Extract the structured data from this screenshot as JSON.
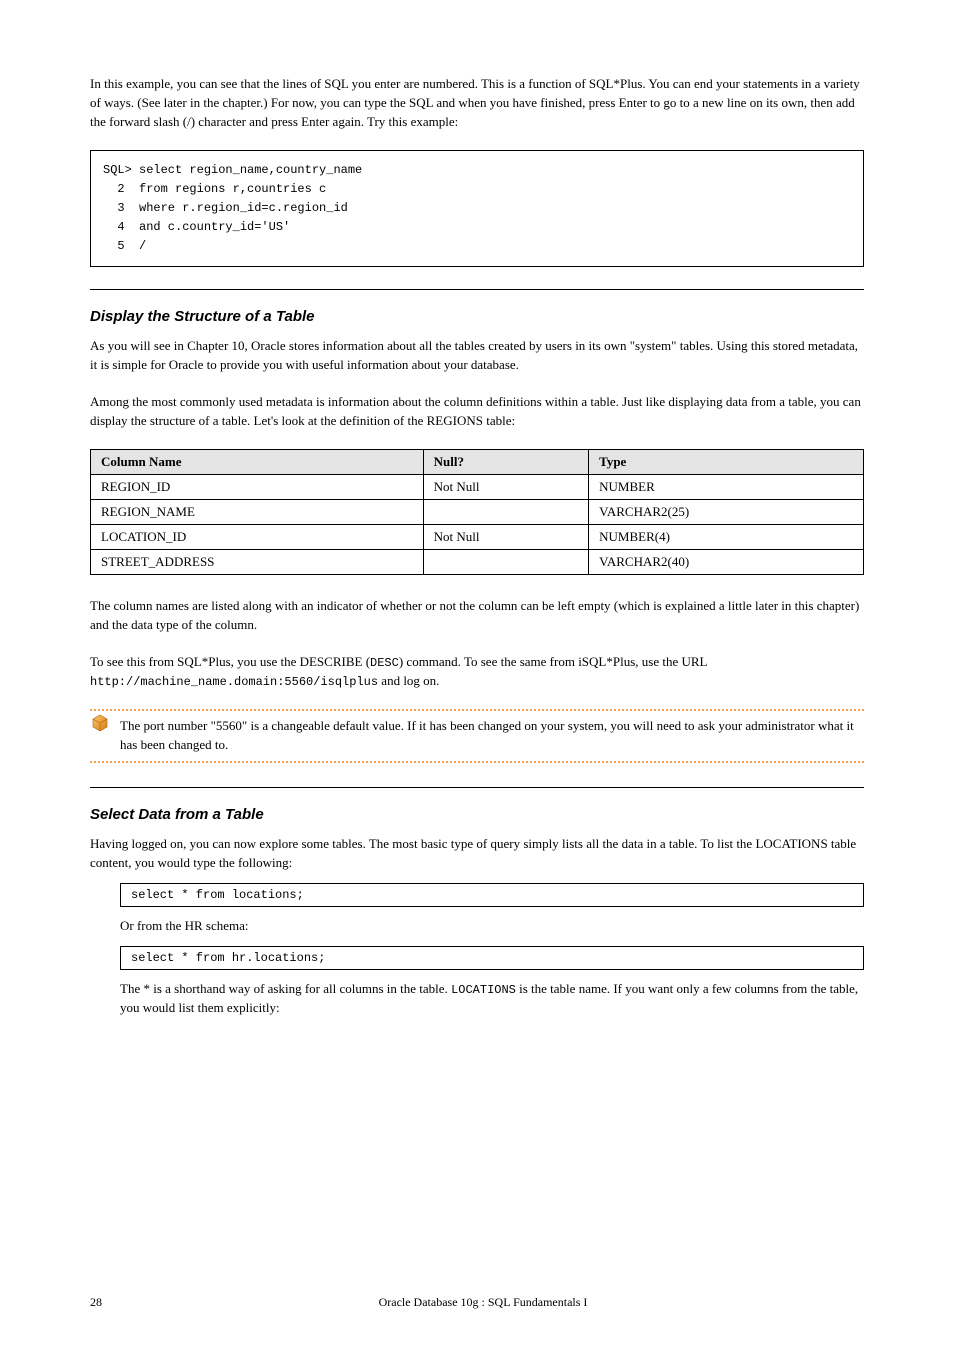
{
  "intro_para": "In this example, you can see that the lines of SQL you enter are numbered. This is a function of SQL*Plus. You can end your statements in a variety of ways. (See later in the chapter.) For now, you can type the SQL and when you have finished, press Enter to go to a new line on its own, then add the forward slash (/) character and press Enter again. Try this example:",
  "example_lines": [
    "SQL> select region_name,country_name",
    "  2  from regions r,countries c",
    "  3  where r.region_id=c.region_id",
    "  4  and c.country_id='US'",
    "  5  /"
  ],
  "section1_title": "Display the Structure of a Table",
  "section1_para1": "As you will see in Chapter 10, Oracle stores information about all the tables created by users in its own \"system\" tables. Using this stored metadata, it is simple for Oracle to provide you with useful information about your database.",
  "section1_para2": "Among the most commonly used metadata is information about the column definitions within a table. Just like displaying data from a table, you can display the structure of a table. Let's look at the definition of the REGIONS table:",
  "table": {
    "headers": [
      "Column Name",
      "Null?",
      "Type"
    ],
    "rows": [
      [
        "REGION_ID",
        "Not Null",
        "NUMBER"
      ],
      [
        "REGION_NAME",
        "",
        "VARCHAR2(25)"
      ],
      [
        "LOCATION_ID",
        "Not Null",
        "NUMBER(4)"
      ],
      [
        "STREET_ADDRESS",
        "",
        "VARCHAR2(40)"
      ]
    ]
  },
  "section1_para3": "The column names are listed along with an indicator of whether or not the column can be left empty (which is explained a little later in this chapter) and the data type of the column.",
  "section1_para4_a": "To see this from SQL*Plus, you use the DESCRIBE (",
  "section1_para4_desc": "DESC",
  "section1_para4_b": ") command. To see the same from iSQL*Plus, use the URL",
  "section1_url": "http://machine_name.domain:5560/isqlplus",
  "section1_para4_c": "and log on.",
  "tip_text": "The port number \"5560\" is a changeable default value. If it has been changed on your system, you will need to ask your administrator what it has been changed to.",
  "section2_title": "Select Data from a Table",
  "section2_para1": "Having logged on, you can now explore some tables. The most basic type of query simply lists all the data in a table. To list the LOCATIONS table content, you would type the following:",
  "code1": "select  *  from locations;",
  "section2_para2": "Or from the HR schema:",
  "code2": "select  *  from hr.locations;",
  "section2_para3_a": "The * is a shorthand way of asking for all columns in the table. ",
  "section2_para3_b": "LOCATIONS",
  "section2_para3_c": " is the table name. If you want only a few columns from the table, you would list them explicitly:",
  "footer": {
    "page_number": "28",
    "book_title": "Oracle Database 10g : SQL Fundamentals I"
  }
}
